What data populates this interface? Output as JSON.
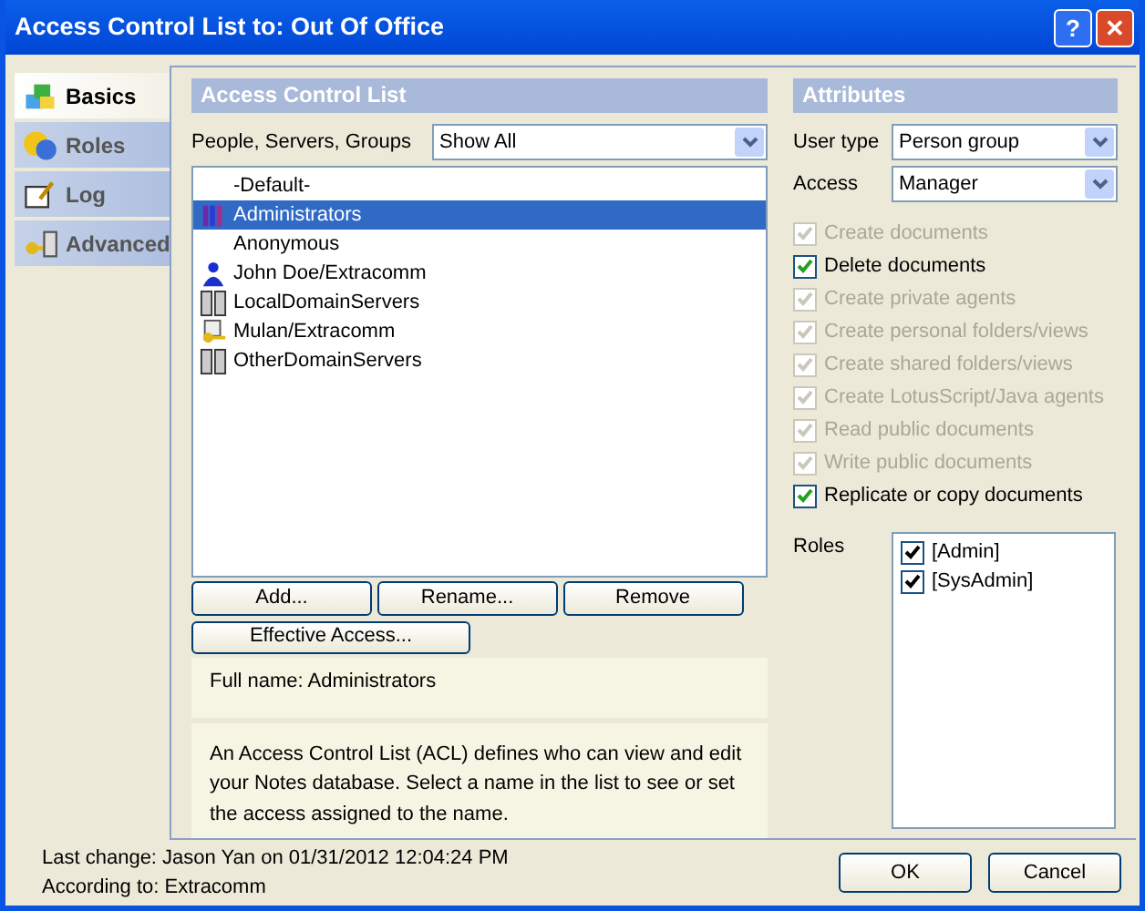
{
  "window": {
    "title": "Access Control List to: Out Of Office",
    "buttons": [
      "?",
      "✕"
    ]
  },
  "sidebar": {
    "items": [
      {
        "label": "Basics",
        "selected": true,
        "kind": "basics"
      },
      {
        "label": "Roles",
        "selected": false,
        "kind": "roles"
      },
      {
        "label": "Log",
        "selected": false,
        "kind": "log"
      },
      {
        "label": "Advanced",
        "selected": false,
        "kind": "advanced"
      }
    ]
  },
  "acl": {
    "header": "Access Control List",
    "filter_label": "People, Servers, Groups",
    "filter_value": "Show All",
    "entries": [
      {
        "name": "-Default-",
        "kind": "none",
        "selected": false
      },
      {
        "name": "Administrators",
        "kind": "group",
        "selected": true
      },
      {
        "name": "Anonymous",
        "kind": "none",
        "selected": false
      },
      {
        "name": "John Doe/Extracomm",
        "kind": "person",
        "selected": false
      },
      {
        "name": "LocalDomainServers",
        "kind": "servers",
        "selected": false
      },
      {
        "name": "Mulan/Extracomm",
        "kind": "keyuser",
        "selected": false
      },
      {
        "name": "OtherDomainServers",
        "kind": "servers",
        "selected": false
      }
    ],
    "buttons": [
      "Add...",
      "Rename...",
      "Remove"
    ],
    "effective_button": "Effective Access...",
    "full_name": "Full name: Administrators",
    "help": "An Access Control List (ACL) defines who can view and edit your Notes database.  Select a name in the list to see or set the access assigned to the name."
  },
  "attributes": {
    "header": "Attributes",
    "user_type_label": "User type",
    "user_type": "Person group",
    "access_label": "Access",
    "access": "Manager",
    "options": [
      {
        "label": "Create documents",
        "checked": true,
        "disabled": true
      },
      {
        "label": "Delete documents",
        "checked": true,
        "disabled": false
      },
      {
        "label": "Create private agents",
        "checked": true,
        "disabled": true
      },
      {
        "label": "Create personal folders/views",
        "checked": true,
        "disabled": true
      },
      {
        "label": "Create shared folders/views",
        "checked": true,
        "disabled": true
      },
      {
        "label": "Create LotusScript/Java agents",
        "checked": true,
        "disabled": true
      },
      {
        "label": "Read public documents",
        "checked": true,
        "disabled": true
      },
      {
        "label": "Write public documents",
        "checked": true,
        "disabled": true
      },
      {
        "label": "Replicate or copy documents",
        "checked": true,
        "disabled": false
      }
    ],
    "roles_label": "Roles",
    "roles": [
      {
        "label": "[Admin]",
        "checked": true
      },
      {
        "label": "[SysAdmin]",
        "checked": true
      }
    ]
  },
  "footer": {
    "last_change": "Last change: Jason Yan on 01/31/2012 12:04:24 PM",
    "according_to": "According to: Extracomm",
    "buttons": [
      "OK",
      "Cancel"
    ]
  }
}
